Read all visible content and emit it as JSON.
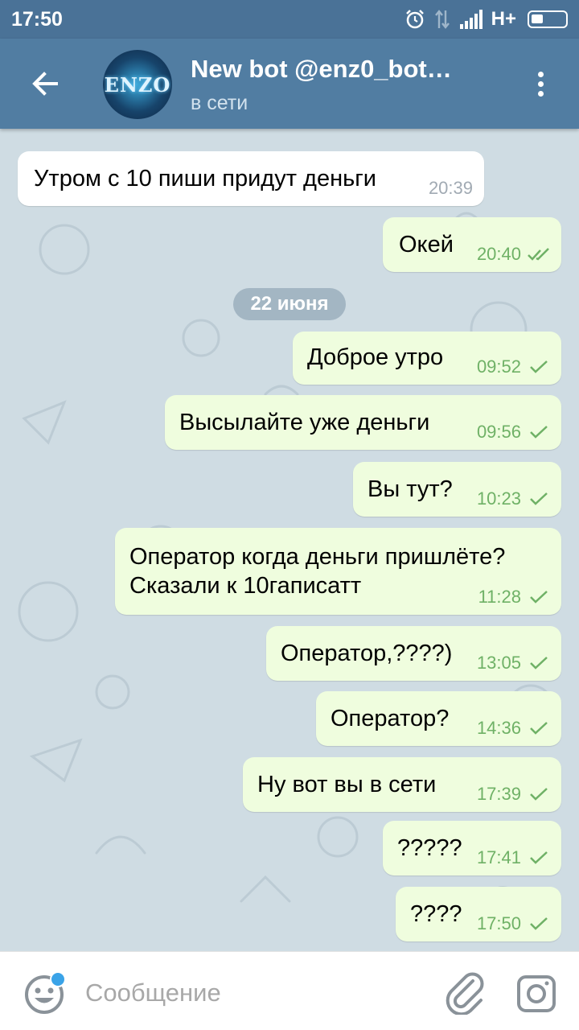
{
  "status_bar": {
    "time": "17:50",
    "network": "H+",
    "icons": [
      "alarm-icon",
      "data-arrows-icon",
      "signal-icon",
      "battery-icon"
    ]
  },
  "header": {
    "title": "New bot @enz0_bot…",
    "subtitle": "в сети",
    "avatar_text": "ENZO",
    "back_icon": "arrow-left-icon",
    "menu_icon": "more-vertical-icon"
  },
  "date_separator": "22 июня",
  "messages": [
    {
      "dir": "in",
      "text": [
        "Утром с 10 пиши придут деньги"
      ],
      "time": "20:39",
      "status": ""
    },
    {
      "dir": "out",
      "text": [
        "Окей"
      ],
      "time": "20:40",
      "status": "read"
    },
    {
      "dir": "out",
      "text": [
        "Доброе утро"
      ],
      "time": "09:52",
      "status": "sent"
    },
    {
      "dir": "out",
      "text": [
        "Высылайте уже деньги"
      ],
      "time": "09:56",
      "status": "sent"
    },
    {
      "dir": "out",
      "text": [
        "Вы тут?"
      ],
      "time": "10:23",
      "status": "sent"
    },
    {
      "dir": "out",
      "text": [
        "Оператор когда деньги пришлёте?",
        "Сказали к 10гаписатт"
      ],
      "time": "11:28",
      "status": "sent"
    },
    {
      "dir": "out",
      "text": [
        "Оператор,????)"
      ],
      "time": "13:05",
      "status": "sent"
    },
    {
      "dir": "out",
      "text": [
        "Оператор?"
      ],
      "time": "14:36",
      "status": "sent"
    },
    {
      "dir": "out",
      "text": [
        "Ну вот вы в сети"
      ],
      "time": "17:39",
      "status": "sent"
    },
    {
      "dir": "out",
      "text": [
        "?????"
      ],
      "time": "17:41",
      "status": "sent"
    },
    {
      "dir": "out",
      "text": [
        "????"
      ],
      "time": "17:50",
      "status": "sent"
    }
  ],
  "input": {
    "placeholder": "Сообщение",
    "value": ""
  },
  "colors": {
    "header": "#517da2",
    "status_bar": "#4a7297",
    "chat_background": "#cfdce3",
    "outgoing_bubble": "#effdde",
    "incoming_bubble": "#ffffff",
    "check_green": "#6fb166",
    "accent_blue": "#3aa3e8"
  }
}
